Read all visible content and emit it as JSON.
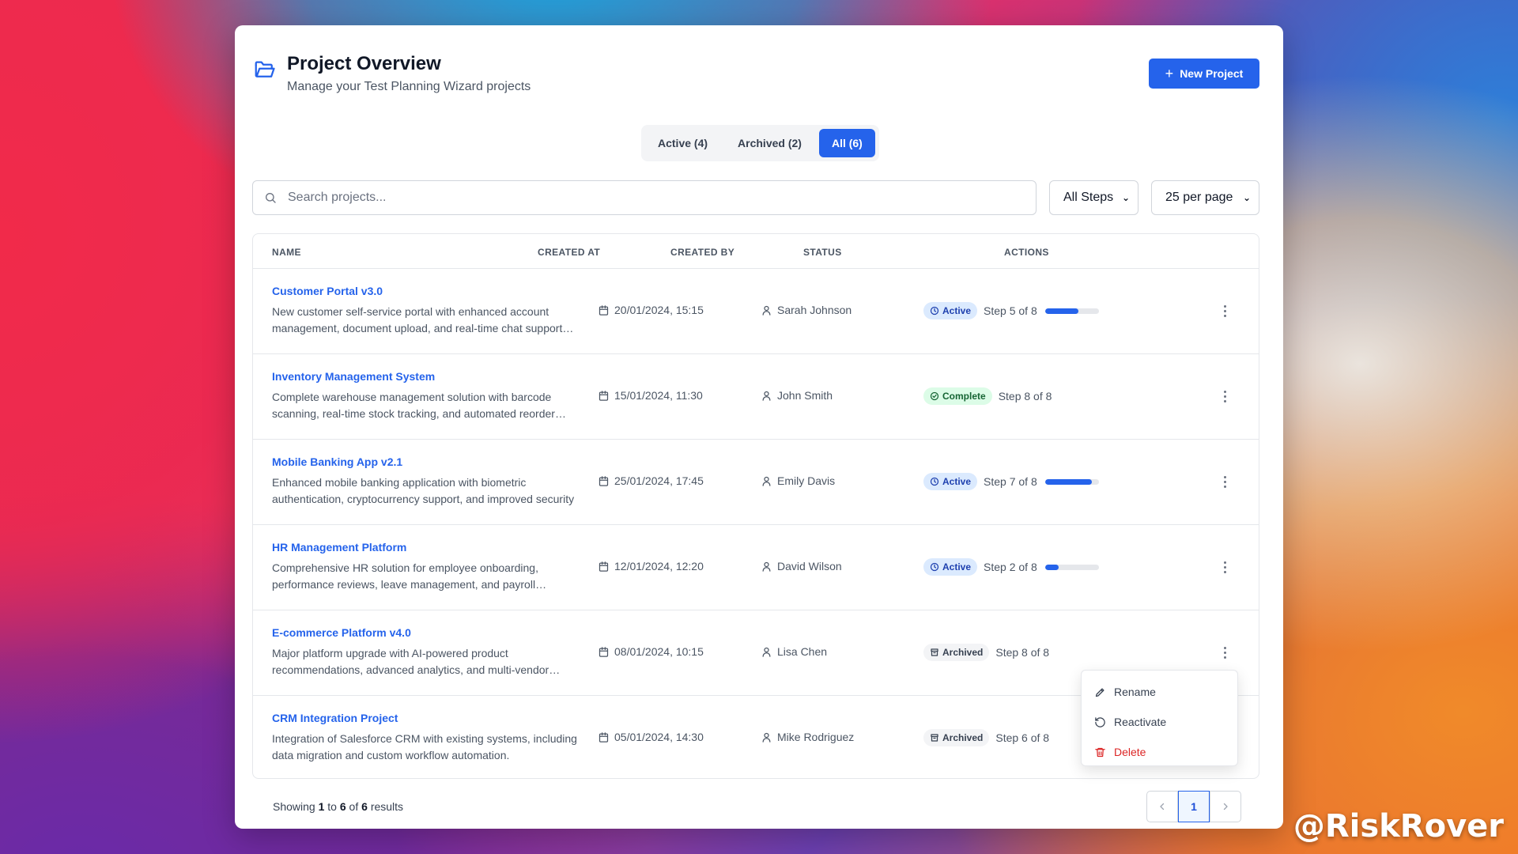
{
  "header": {
    "title": "Project Overview",
    "subtitle": "Manage your Test Planning Wizard projects",
    "new_button": "New Project"
  },
  "tabs": [
    {
      "label": "Active (4)",
      "active": false
    },
    {
      "label": "Archived (2)",
      "active": false
    },
    {
      "label": "All (6)",
      "active": true
    }
  ],
  "search": {
    "placeholder": "Search projects..."
  },
  "filters": {
    "steps": "All Steps",
    "per_page": "25 per page"
  },
  "table": {
    "headers": {
      "name": "NAME",
      "created_at": "CREATED AT",
      "created_by": "CREATED BY",
      "status": "STATUS",
      "actions": "ACTIONS"
    },
    "rows": [
      {
        "name": "Customer Portal v3.0",
        "description": "New customer self-service portal with enhanced account management, document upload, and real-time chat support features",
        "created_at": "20/01/2024, 15:15",
        "created_by": "Sarah Johnson",
        "status": "Active",
        "step": "Step 5 of 8",
        "progress": 0.625
      },
      {
        "name": "Inventory Management System",
        "description": "Complete warehouse management solution with barcode scanning, real-time stock tracking, and automated reorder alerts",
        "created_at": "15/01/2024, 11:30",
        "created_by": "John Smith",
        "status": "Complete",
        "step": "Step 8 of 8",
        "progress": null
      },
      {
        "name": "Mobile Banking App v2.1",
        "description": "Enhanced mobile banking application with biometric authentication, cryptocurrency support, and improved security",
        "created_at": "25/01/2024, 17:45",
        "created_by": "Emily Davis",
        "status": "Active",
        "step": "Step 7 of 8",
        "progress": 0.875
      },
      {
        "name": "HR Management Platform",
        "description": "Comprehensive HR solution for employee onboarding, performance reviews, leave management, and payroll integration",
        "created_at": "12/01/2024, 12:20",
        "created_by": "David Wilson",
        "status": "Active",
        "step": "Step 2 of 8",
        "progress": 0.25
      },
      {
        "name": "E-commerce Platform v4.0",
        "description": "Major platform upgrade with AI-powered product recommendations, advanced analytics, and multi-vendor marketplace",
        "created_at": "08/01/2024, 10:15",
        "created_by": "Lisa Chen",
        "status": "Archived",
        "step": "Step 8 of 8",
        "progress": null
      },
      {
        "name": "CRM Integration Project",
        "description": "Integration of Salesforce CRM with existing systems, including data migration and custom workflow automation.",
        "created_at": "05/01/2024, 14:30",
        "created_by": "Mike Rodriguez",
        "status": "Archived",
        "step": "Step 6 of 8",
        "progress": null
      }
    ]
  },
  "menu": {
    "rename": "Rename",
    "reactivate": "Reactivate",
    "delete": "Delete"
  },
  "footer": {
    "showing": "Showing",
    "from": "1",
    "to_word": "to",
    "to": "6",
    "of_word": "of",
    "total": "6",
    "results": "results"
  },
  "pagination": {
    "current": "1"
  },
  "watermark": "@RiskRover",
  "colors": {
    "accent": "#2563eb",
    "danger": "#dc2626"
  }
}
